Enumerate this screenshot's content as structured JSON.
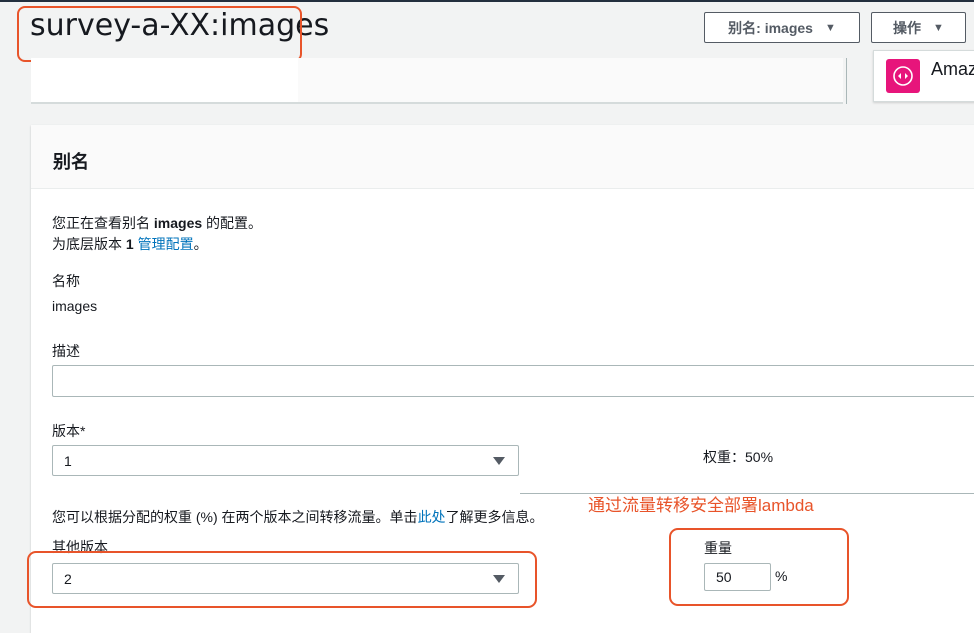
{
  "header": {
    "title": "survey-a-XX:images",
    "alias_button": "别名: images",
    "actions_button": "操作"
  },
  "side_card": {
    "text": "Amaz"
  },
  "panel": {
    "title": "别名",
    "intro_prefix": "您正在查看别名 ",
    "intro_alias": "images",
    "intro_suffix": " 的配置。",
    "base_prefix": "为底层版本 ",
    "base_version": "1",
    "base_link": "管理配置",
    "base_suffix": "。",
    "name_label": "名称",
    "name_value": "images",
    "desc_label": "描述",
    "desc_value": "",
    "version_label": "版本*",
    "version_value": "1",
    "weight_readout": "权重：50%",
    "weight_percent": 50,
    "traffic_prefix": "您可以根据分配的权重 (%) 在两个版本之间转移流量。单击",
    "traffic_link": "此处",
    "traffic_suffix": "了解更多信息。",
    "other_version_label": "其他版本",
    "other_version_value": "2",
    "weight_label": "重量",
    "weight_input_value": "50",
    "percent_sign": "%"
  },
  "annotation": {
    "text": "通过流量转移安全部署lambda",
    "color": "#e8542a"
  },
  "colors": {
    "link": "#0073bb",
    "annotation": "#e8542a",
    "title_bar": "#232f3e"
  }
}
